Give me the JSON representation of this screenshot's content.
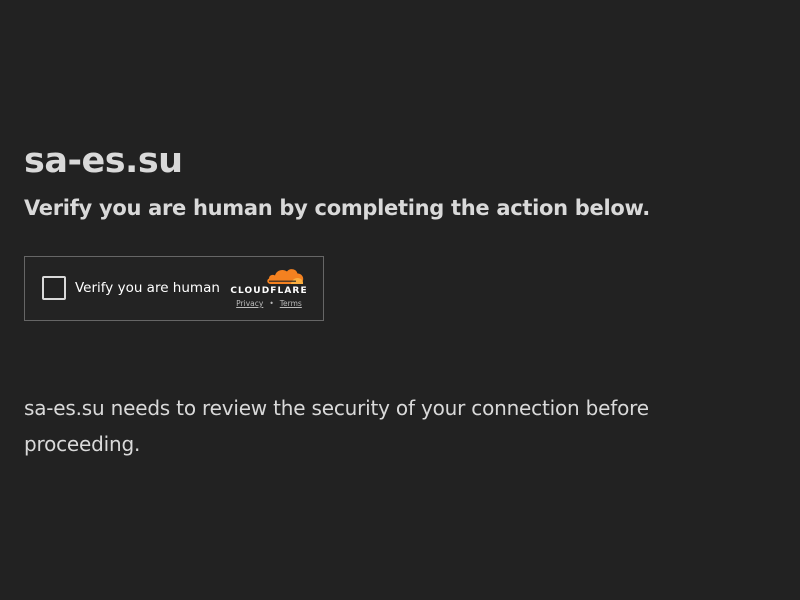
{
  "site": {
    "domain_title": "sa-es.su",
    "subtitle": "Verify you are human by completing the action below."
  },
  "challenge": {
    "checkbox_label": "Verify you are human",
    "checked": false,
    "brand_name": "CLOUDFLARE",
    "brand_icon": "cloud-icon",
    "brand_color": "#f48120",
    "privacy_link": "Privacy",
    "separator": "•",
    "terms_link": "Terms"
  },
  "message": {
    "text": "sa-es.su needs to review the security of your connection before proceeding."
  },
  "colors": {
    "background": "#222222",
    "text": "#d9d9d9",
    "widget_border": "#666666"
  }
}
